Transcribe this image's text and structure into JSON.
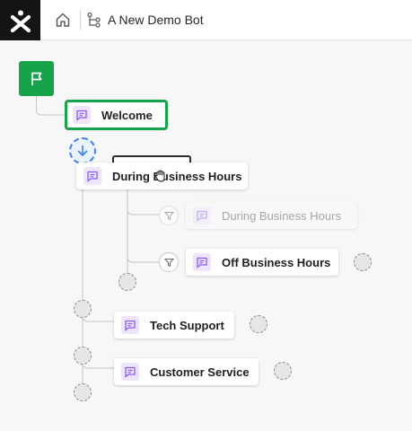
{
  "header": {
    "bot_name": "A New Demo Bot",
    "logo_icon": "brand-logo-icon",
    "home_icon": "home-icon",
    "flow_icon": "flow-tree-icon"
  },
  "colors": {
    "accent_green": "#16a34a",
    "message_icon_bg": "#ede5fb",
    "message_icon": "#8b5cf6",
    "drop_target": "#3b82f6"
  },
  "nodes": {
    "welcome": "Welcome",
    "dragging": "During Business Hours",
    "branch_ghost": "During Business Hours",
    "branch_off": "Off Business Hours",
    "tech_support": "Tech Support",
    "customer_service": "Customer Service"
  }
}
